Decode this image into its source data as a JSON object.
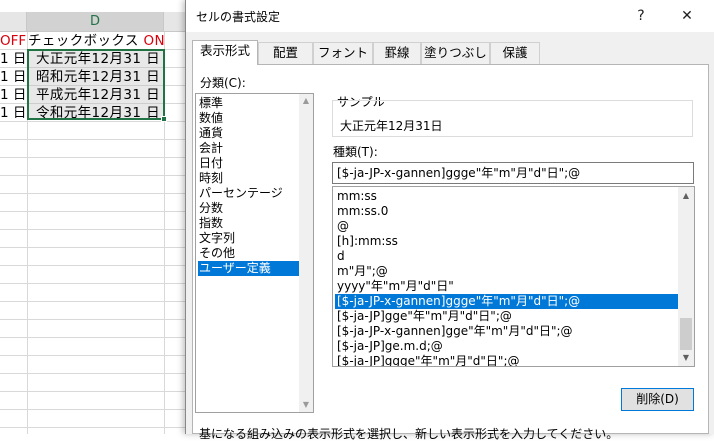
{
  "sheet": {
    "column_d_header": "D",
    "rows": [
      {
        "c": "OFF",
        "d": "チェックボックス ON"
      },
      {
        "c": "1 日",
        "d": "大正元年12月31 日"
      },
      {
        "c": "1 日",
        "d": "昭和元年12月31 日"
      },
      {
        "c": "1 日",
        "d": "平成元年12月31 日"
      },
      {
        "c": "1 日",
        "d": "令和元年12月31 日"
      }
    ],
    "accent_color": "#217346"
  },
  "dialog": {
    "title": "セルの書式設定",
    "help_glyph": "?",
    "close_glyph": "✕",
    "tabs": [
      "表示形式",
      "配置",
      "フォント",
      "罫線",
      "塗りつぶし",
      "保護"
    ],
    "active_tab": "表示形式",
    "category_label": "分類(C):",
    "categories": [
      "標準",
      "数値",
      "通貨",
      "会計",
      "日付",
      "時刻",
      "パーセンテージ",
      "分数",
      "指数",
      "文字列",
      "その他",
      "ユーザー定義"
    ],
    "selected_category": "ユーザー定義",
    "sample_label": "サンプル",
    "sample_value": "大正元年12月31日",
    "type_label": "種類(T):",
    "type_input_value": "[$-ja-JP-x-gannen]ggge\"年\"m\"月\"d\"日\";@",
    "formats": [
      "mm:ss",
      "mm:ss.0",
      "@",
      "[h]:mm:ss",
      "d",
      "m\"月\";@",
      "yyyy\"年\"m\"月\"d\"日\"",
      "[$-ja-JP-x-gannen]ggge\"年\"m\"月\"d\"日\";@",
      "[$-ja-JP]gge\"年\"m\"月\"d\"日\";@",
      "[$-ja-JP-x-gannen]gge\"年\"m\"月\"d\"日\";@",
      "[$-ja-JP]ge.m.d;@",
      "[$-ja-JP]ggge\"年\"m\"月\"d\"日\";@"
    ],
    "selected_format_index": 7,
    "delete_button": "削除(D)",
    "hint_text": "基になる組み込みの表示形式を選択し、新しい表示形式を入力してください。",
    "selection_color": "#0078d7"
  }
}
